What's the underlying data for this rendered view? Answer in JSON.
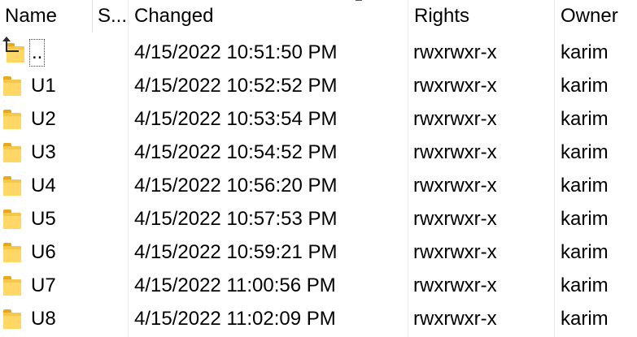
{
  "columns": {
    "name": "Name",
    "size": "S...",
    "changed": "Changed",
    "rights": "Rights",
    "owner": "Owner"
  },
  "rows": [
    {
      "name": "..",
      "changed": "4/15/2022 10:51:50 PM",
      "rights": "rwxrwxr-x",
      "owner": "karim",
      "icon": "parent-directory-icon"
    },
    {
      "name": "U1",
      "changed": "4/15/2022 10:52:52 PM",
      "rights": "rwxrwxr-x",
      "owner": "karim",
      "icon": "folder-icon"
    },
    {
      "name": "U2",
      "changed": "4/15/2022 10:53:54 PM",
      "rights": "rwxrwxr-x",
      "owner": "karim",
      "icon": "folder-icon"
    },
    {
      "name": "U3",
      "changed": "4/15/2022 10:54:52 PM",
      "rights": "rwxrwxr-x",
      "owner": "karim",
      "icon": "folder-icon"
    },
    {
      "name": "U4",
      "changed": "4/15/2022 10:56:20 PM",
      "rights": "rwxrwxr-x",
      "owner": "karim",
      "icon": "folder-icon"
    },
    {
      "name": "U5",
      "changed": "4/15/2022 10:57:53 PM",
      "rights": "rwxrwxr-x",
      "owner": "karim",
      "icon": "folder-icon"
    },
    {
      "name": "U6",
      "changed": "4/15/2022 10:59:21 PM",
      "rights": "rwxrwxr-x",
      "owner": "karim",
      "icon": "folder-icon"
    },
    {
      "name": "U7",
      "changed": "4/15/2022 11:00:56 PM",
      "rights": "rwxrwxr-x",
      "owner": "karim",
      "icon": "folder-icon"
    },
    {
      "name": "U8",
      "changed": "4/15/2022 11:02:09 PM",
      "rights": "rwxrwxr-x",
      "owner": "karim",
      "icon": "folder-icon"
    }
  ],
  "colors": {
    "folder": "#f5c84c",
    "folder_tab": "#e8a918",
    "text": "#000000",
    "background": "#ffffff"
  }
}
